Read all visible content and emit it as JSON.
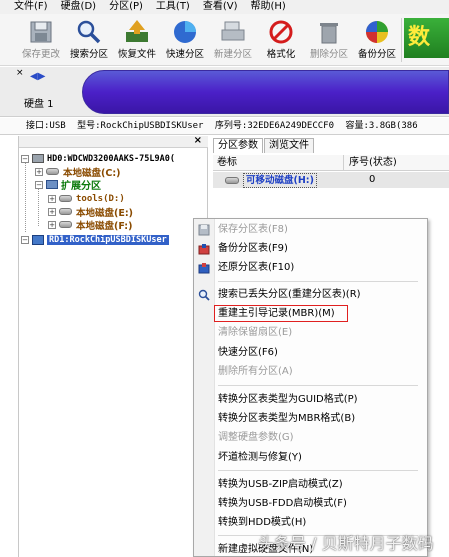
{
  "menubar": {
    "items": [
      "文件(F)",
      "硬盘(D)",
      "分区(P)",
      "工具(T)",
      "查看(V)",
      "帮助(H)"
    ]
  },
  "toolbar": {
    "buttons": [
      {
        "label": "保存更改",
        "icon": "save-icon",
        "enabled": false
      },
      {
        "label": "搜索分区",
        "icon": "search-icon",
        "enabled": true
      },
      {
        "label": "恢复文件",
        "icon": "recover-files-icon",
        "enabled": true
      },
      {
        "label": "快速分区",
        "icon": "quick-partition-icon",
        "enabled": true
      },
      {
        "label": "新建分区",
        "icon": "new-partition-icon",
        "enabled": false
      },
      {
        "label": "格式化",
        "icon": "format-icon",
        "enabled": true
      },
      {
        "label": "删除分区",
        "icon": "delete-partition-icon",
        "enabled": false
      },
      {
        "label": "备份分区",
        "icon": "backup-partition-icon",
        "enabled": true
      }
    ],
    "partial_logo_text": "数"
  },
  "diskband": {
    "close": "×",
    "nav": "◀▶",
    "disk_label": "硬盘 1"
  },
  "infoline": {
    "interface": "接口:USB",
    "model": "型号:RockChipUSBDISKUser",
    "serial": "序列号:32EDE6A249DECCF0",
    "capacity": "容量:3.8GB(386"
  },
  "tree": {
    "close": "×",
    "nodes": [
      {
        "expander": "−",
        "text": "HD0:WDCWD3200AAKS-75L9A0(",
        "icon": "hdd-icon"
      },
      {
        "expander": "+",
        "text": "本地磁盘(C:)",
        "icon": "volume-icon"
      },
      {
        "expander": "−",
        "text": "扩展分区",
        "icon": "extended-partition-icon"
      },
      {
        "expander": "+",
        "text": "tools(D:)",
        "icon": "volume-icon"
      },
      {
        "expander": "+",
        "text": "本地磁盘(E:)",
        "icon": "volume-icon"
      },
      {
        "expander": "+",
        "text": "本地磁盘(F:)",
        "icon": "volume-icon"
      },
      {
        "expander": "−",
        "text": "RD1:RockChipUSBDISKUser",
        "icon": "usb-disk-icon"
      }
    ]
  },
  "right": {
    "tabs": [
      "分区参数",
      "浏览文件"
    ],
    "columns": [
      "卷标",
      "序号(状态)"
    ],
    "row": {
      "name": "可移动磁盘(H:)",
      "seq": "0"
    }
  },
  "context_menu": {
    "items": [
      {
        "label": "保存分区表(F8)",
        "enabled": false,
        "icon": "save-table-icon"
      },
      {
        "label": "备份分区表(F9)",
        "enabled": true,
        "icon": "backup-table-icon"
      },
      {
        "label": "还原分区表(F10)",
        "enabled": true,
        "icon": "restore-table-icon"
      },
      {
        "label": "搜索已丢失分区(重建分区表)(R)",
        "enabled": true,
        "icon": "search-lost-icon"
      },
      {
        "label": "重建主引导记录(MBR)(M)",
        "enabled": true,
        "icon": ""
      },
      {
        "label": "清除保留扇区(E)",
        "enabled": false,
        "icon": ""
      },
      {
        "label": "快速分区(F6)",
        "enabled": true,
        "icon": ""
      },
      {
        "label": "删除所有分区(A)",
        "enabled": false,
        "icon": ""
      },
      {
        "label": "转换分区表类型为GUID格式(P)",
        "enabled": true,
        "icon": ""
      },
      {
        "label": "转换分区表类型为MBR格式(B)",
        "enabled": true,
        "icon": ""
      },
      {
        "label": "调整硬盘参数(G)",
        "enabled": false,
        "icon": ""
      },
      {
        "label": "坏道检测与修复(Y)",
        "enabled": true,
        "icon": ""
      },
      {
        "label": "转换为USB-ZIP启动模式(Z)",
        "enabled": true,
        "icon": ""
      },
      {
        "label": "转换为USB-FDD启动模式(F)",
        "enabled": true,
        "icon": ""
      },
      {
        "label": "转换到HDD模式(H)",
        "enabled": true,
        "icon": ""
      },
      {
        "label": "新建虚拟硬盘文件(N)",
        "enabled": true,
        "icon": ""
      }
    ]
  },
  "watermark": "头条号 / 贝斯特月子数码",
  "colors": {
    "disk_bar": "#4b20c8",
    "selection": "#3261c8",
    "highlight_box": "#e02020",
    "tree_brown": "#8a4b00",
    "tree_green": "#0c7a0c"
  }
}
